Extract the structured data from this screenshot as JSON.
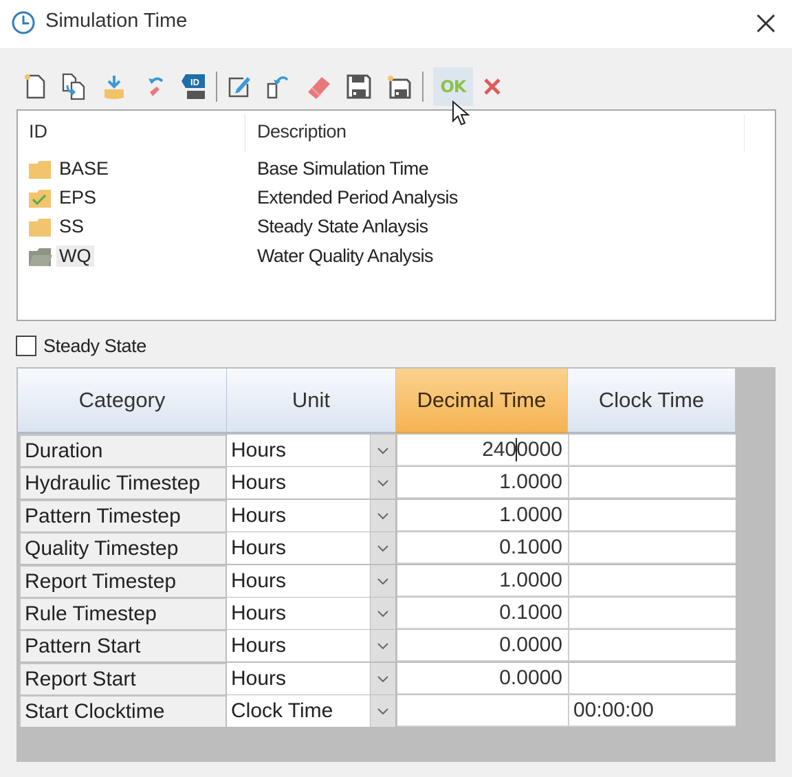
{
  "window": {
    "title": "Simulation Time",
    "title_icon": "clock-icon",
    "close_icon": "close-icon"
  },
  "toolbar": {
    "buttons": [
      {
        "name": "new",
        "icon": "new-document-icon"
      },
      {
        "name": "duplicate",
        "icon": "duplicate-icon"
      },
      {
        "name": "import",
        "icon": "import-icon"
      },
      {
        "name": "undo-delete",
        "icon": "restore-icon"
      },
      {
        "name": "id-tag",
        "icon": "id-tag-icon"
      },
      {
        "name": "edit",
        "icon": "edit-icon"
      },
      {
        "name": "revert",
        "icon": "revert-icon"
      },
      {
        "name": "delete",
        "icon": "eraser-icon"
      },
      {
        "name": "save",
        "icon": "save-icon"
      },
      {
        "name": "save-as",
        "icon": "save-as-icon"
      }
    ],
    "ok_label": "OK",
    "cancel_icon": "cancel-x-icon"
  },
  "scenarios": {
    "columns": {
      "id": "ID",
      "description": "Description"
    },
    "rows": [
      {
        "id": "BASE",
        "description": "Base Simulation Time",
        "icon": "folder-icon",
        "active": false,
        "selected": false
      },
      {
        "id": "EPS",
        "description": "Extended Period Analysis",
        "icon": "folder-check-icon",
        "active": true,
        "selected": false
      },
      {
        "id": "SS",
        "description": "Steady State Anlaysis",
        "icon": "folder-icon",
        "active": false,
        "selected": false
      },
      {
        "id": "WQ",
        "description": "Water Quality Analysis",
        "icon": "folder-open-icon",
        "active": false,
        "selected": true
      }
    ]
  },
  "steady_state": {
    "label": "Steady State",
    "checked": false
  },
  "grid": {
    "headers": {
      "category": "Category",
      "unit": "Unit",
      "decimal": "Decimal Time",
      "clock": "Clock Time"
    },
    "active_column": "decimal",
    "rows": [
      {
        "category": "Duration",
        "unit": "Hours",
        "decimal_before_caret": "240",
        "decimal_after_caret": "0000",
        "decimal": "240.0000",
        "clock": ""
      },
      {
        "category": "Hydraulic Timestep",
        "unit": "Hours",
        "decimal": "1.0000",
        "clock": ""
      },
      {
        "category": "Pattern Timestep",
        "unit": "Hours",
        "decimal": "1.0000",
        "clock": ""
      },
      {
        "category": "Quality Timestep",
        "unit": "Hours",
        "decimal": "0.1000",
        "clock": ""
      },
      {
        "category": "Report Timestep",
        "unit": "Hours",
        "decimal": "1.0000",
        "clock": ""
      },
      {
        "category": "Rule Timestep",
        "unit": "Hours",
        "decimal": "0.1000",
        "clock": ""
      },
      {
        "category": "Pattern Start",
        "unit": "Hours",
        "decimal": "0.0000",
        "clock": ""
      },
      {
        "category": "Report Start",
        "unit": "Hours",
        "decimal": "0.0000",
        "clock": ""
      },
      {
        "category": "Start Clocktime",
        "unit": "Clock Time",
        "decimal": "",
        "clock": "00:00:00"
      }
    ]
  },
  "colors": {
    "active_header": "#f5b352",
    "ok_green": "#8bc34a",
    "cancel_red": "#e05a5a",
    "folder_yellow": "#f2c46d"
  }
}
